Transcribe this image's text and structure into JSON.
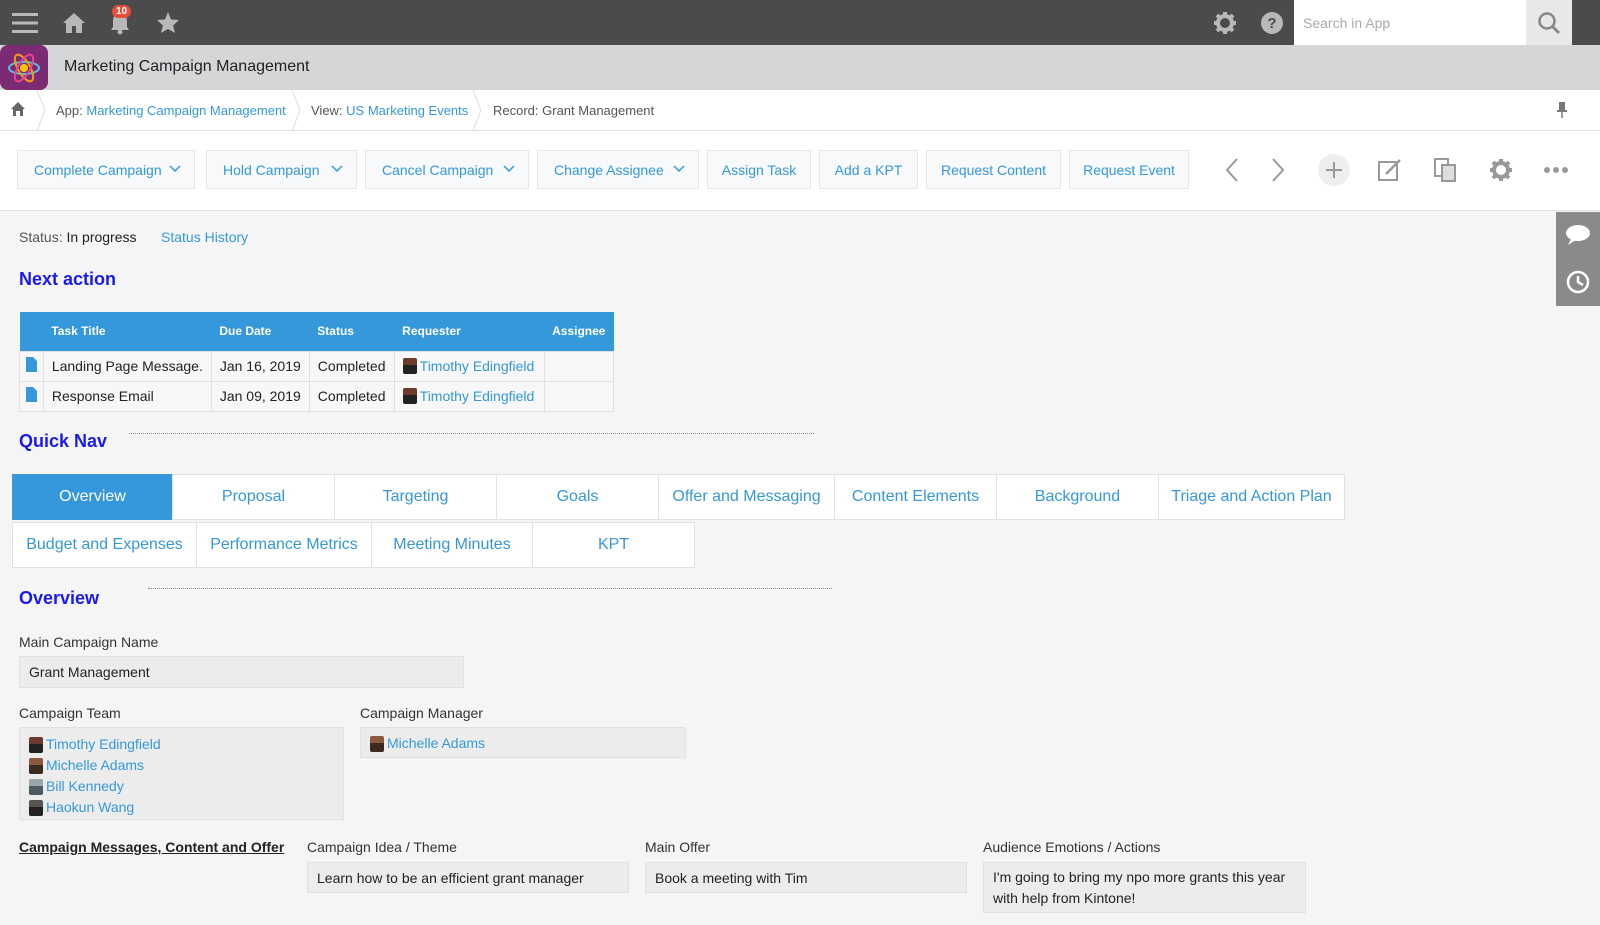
{
  "topbar": {
    "notification_count": "10",
    "search_placeholder": "Search in App",
    "icons": [
      "menu-icon",
      "home-icon",
      "bell-icon",
      "star-icon",
      "gear-icon",
      "help-icon",
      "search-icon"
    ]
  },
  "app": {
    "title": "Marketing Campaign Management"
  },
  "breadcrumb": {
    "app_prefix": "App: ",
    "app_link": "Marketing Campaign Management",
    "view_prefix": "View: ",
    "view_link": "US Marketing Events",
    "record": "Record: Grant Management"
  },
  "toolbar": {
    "buttons": [
      {
        "label": "Complete Campaign",
        "dropdown": true
      },
      {
        "label": "Hold Campaign",
        "dropdown": true
      },
      {
        "label": "Cancel Campaign",
        "dropdown": true
      },
      {
        "label": "Change Assignee",
        "dropdown": true
      },
      {
        "label": "Assign Task",
        "dropdown": false
      },
      {
        "label": "Add a KPT",
        "dropdown": false
      },
      {
        "label": "Request Content",
        "dropdown": false
      },
      {
        "label": "Request Event",
        "dropdown": false
      }
    ],
    "icons": [
      "chevron-left-icon",
      "chevron-right-icon",
      "add-icon",
      "edit-icon",
      "duplicate-icon",
      "gear-icon",
      "more-icon"
    ]
  },
  "status": {
    "label": "Status: ",
    "value": "In progress",
    "history_link": "Status History"
  },
  "next_action": {
    "title": "Next action",
    "columns": [
      "Task Title",
      "Due Date",
      "Status",
      "Requester",
      "Assignee"
    ],
    "rows": [
      {
        "title": "Landing Page Message.",
        "due": "Jan 16, 2019",
        "status": "Completed",
        "requester": "Timothy Edingfield",
        "assignee": ""
      },
      {
        "title": "Response Email",
        "due": "Jan 09, 2019",
        "status": "Completed",
        "requester": "Timothy Edingfield",
        "assignee": ""
      }
    ]
  },
  "quick_nav": {
    "title": "Quick Nav",
    "row1": [
      "Overview",
      "Proposal",
      "Targeting",
      "Goals",
      "Offer and Messaging",
      "Content Elements",
      "Background",
      "Triage and Action Plan"
    ],
    "row2": [
      "Budget and Expenses",
      "Performance Metrics",
      "Meeting Minutes",
      "KPT"
    ],
    "active": "Overview"
  },
  "overview": {
    "title": "Overview",
    "main_campaign_name_label": "Main Campaign Name",
    "main_campaign_name": "Grant Management",
    "campaign_team_label": "Campaign Team",
    "campaign_team": [
      "Timothy Edingfield",
      "Michelle Adams",
      "Bill Kennedy",
      "Haokun Wang"
    ],
    "campaign_manager_label": "Campaign Manager",
    "campaign_manager": "Michelle Adams",
    "messages_heading": "Campaign Messages, Content and Offer",
    "idea_label": "Campaign Idea / Theme",
    "idea_value": "Learn how to be an efficient grant manager",
    "offer_label": "Main Offer",
    "offer_value": "Book a meeting with Tim",
    "emotions_label": "Audience Emotions / Actions",
    "emotions_value": "I'm going to bring my npo more grants this year with help from Kintone!"
  },
  "colors": {
    "accent": "#3498db",
    "heading": "#1a1af0",
    "topbar": "#4b4b4b",
    "app_logo": "#7b2b73"
  }
}
